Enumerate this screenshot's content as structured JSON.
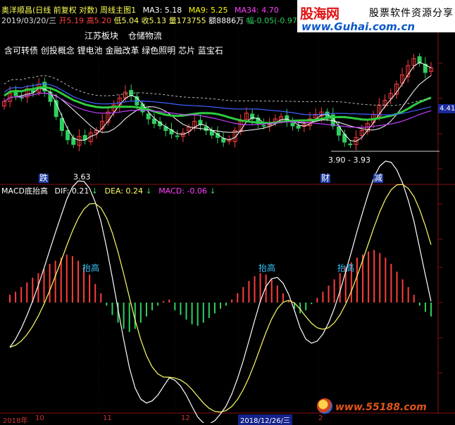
{
  "header": {
    "line1_prefix": "奥洋顺昌(日线 前复权 对数) 周线主图1",
    "ma3_label": "MA3: 5.18",
    "ma9_label": "MA9: 5.25",
    "ma34_label": "MA34: 4.70",
    "line2_date": "2019/03/20/三",
    "open_label": "开5.19",
    "high_label": "高5.20",
    "low_label": "低5.04",
    "close_label": "收5.13",
    "volume_label": "量173755",
    "amount_label": "额8886万",
    "amplitude_label": "幅-0.05(-0.97",
    "sector1": "江苏板块",
    "sector2": "仓储物流",
    "concepts": "含可转债 创投概念 锂电池 金融改革 绿色照明 芯片 蓝宝石"
  },
  "banner": {
    "brand": "股海网",
    "tagline": "股票软件资源分享",
    "url": "www.Guhai.com.cn"
  },
  "price_annotations": {
    "low_label": "3.63",
    "range_label": "3.90 - 3.93",
    "signal_die": "跌",
    "signal_cai": "财",
    "signal_jian": "减",
    "right_value": "4.41"
  },
  "macd_panel": {
    "title": "MACD底抬高",
    "dif_label": "DIF: 0.21",
    "dea_label": "DEA: 0.24",
    "macd_label": "MACD: -0.06",
    "annotations": [
      "抬高",
      "抬高",
      "抬高"
    ]
  },
  "x_axis": {
    "labels": [
      "2018年",
      "10",
      "11",
      "12",
      "2018/12/26/三",
      "2"
    ]
  },
  "watermark": {
    "url": "www.55188.com"
  },
  "colors": {
    "up": "#ff3c3c",
    "down": "#2fd05f",
    "ma_green": "#2ecc40",
    "ma_white": "#ffffff",
    "ma_purple": "#c040ff",
    "ma_blue": "#4060ff",
    "dif": "#ffffff",
    "dea": "#ffff66",
    "header_yellow": "#ffff00",
    "header_purple": "#ff40ff"
  },
  "chart_data": [
    {
      "type": "candlestick",
      "title": "",
      "scale": "log",
      "series": [
        {
          "name": "MA3",
          "last": 5.18
        },
        {
          "name": "MA9",
          "last": 5.25
        },
        {
          "name": "MA34",
          "last": 4.7
        }
      ],
      "annotations": [
        {
          "text": "3.63",
          "kind": "low"
        },
        {
          "text": "3.90 - 3.93",
          "kind": "range"
        }
      ],
      "close_relative": [
        0.55,
        0.62,
        0.6,
        0.58,
        0.66,
        0.63,
        0.7,
        0.64,
        0.55,
        0.42,
        0.3,
        0.22,
        0.18,
        0.25,
        0.22,
        0.28,
        0.3,
        0.38,
        0.46,
        0.52,
        0.58,
        0.63,
        0.6,
        0.52,
        0.46,
        0.4,
        0.36,
        0.34,
        0.3,
        0.27,
        0.25,
        0.28,
        0.33,
        0.38,
        0.35,
        0.3,
        0.26,
        0.24,
        0.2,
        0.22,
        0.3,
        0.38,
        0.45,
        0.4,
        0.36,
        0.34,
        0.36,
        0.4,
        0.42,
        0.38,
        0.34,
        0.32,
        0.35,
        0.4,
        0.44,
        0.46,
        0.42,
        0.34,
        0.26,
        0.2,
        0.18,
        0.24,
        0.3,
        0.36,
        0.44,
        0.52,
        0.56,
        0.62,
        0.7,
        0.78,
        0.86,
        0.92,
        0.88,
        0.8,
        0.84
      ]
    },
    {
      "type": "bar",
      "title": "MACD底抬高",
      "series": [
        {
          "name": "DIF",
          "last": 0.21
        },
        {
          "name": "DEA",
          "last": 0.24
        },
        {
          "name": "MACD",
          "last": -0.06
        }
      ],
      "macd_hist": [
        0.1,
        0.14,
        0.2,
        0.26,
        0.32,
        0.38,
        0.44,
        0.5,
        0.54,
        0.58,
        0.62,
        0.6,
        0.54,
        0.46,
        0.36,
        0.24,
        0.12,
        -0.04,
        -0.16,
        -0.26,
        -0.34,
        -0.38,
        -0.34,
        -0.26,
        -0.18,
        -0.1,
        -0.04,
        0.02,
        0.04,
        -0.1,
        -0.16,
        -0.22,
        -0.28,
        -0.3,
        -0.26,
        -0.2,
        -0.14,
        -0.08,
        -0.04,
        0.04,
        0.12,
        0.2,
        0.28,
        0.34,
        0.38,
        0.36,
        0.3,
        0.22,
        0.12,
        0.02,
        -0.08,
        -0.14,
        -0.1,
        -0.02,
        0.06,
        0.14,
        0.22,
        0.3,
        0.38,
        0.46,
        0.52,
        0.58,
        0.62,
        0.66,
        0.68,
        0.64,
        0.58,
        0.5,
        0.4,
        0.3,
        0.2,
        0.1,
        -0.04,
        -0.12,
        -0.18
      ]
    }
  ]
}
